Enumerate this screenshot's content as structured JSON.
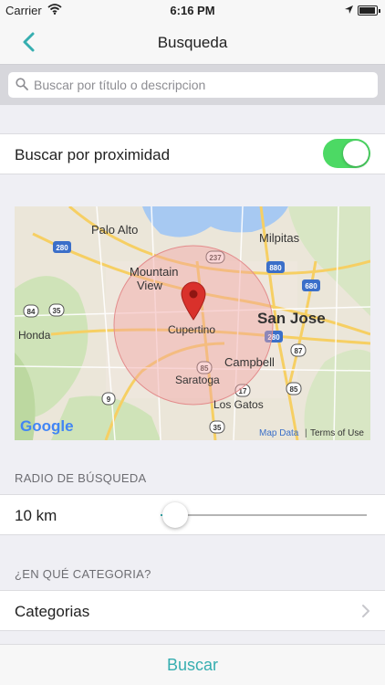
{
  "status_bar": {
    "carrier": "Carrier",
    "time": "6:16 PM",
    "battery_level": 0.95,
    "icons": [
      "wifi-icon",
      "location-arrow-icon",
      "battery-icon"
    ]
  },
  "nav": {
    "title": "Busqueda",
    "back_icon": "chevron-left-icon"
  },
  "search": {
    "placeholder": "Buscar por título o descripcion",
    "value": ""
  },
  "proximity": {
    "label": "Buscar por proximidad",
    "enabled": true
  },
  "map": {
    "provider_logo": "Google",
    "map_data_label": "Map Data",
    "separator": "|",
    "terms_label": "Terms of Use",
    "places": [
      "Palo Alto",
      "Milpitas",
      "Mountain",
      "View",
      "San Jose",
      "Cupertino",
      "Campbell",
      "Saratoga",
      "Los Gatos",
      "Honda"
    ],
    "shields": [
      "280",
      "237",
      "880",
      "680",
      "84",
      "35",
      "85",
      "280",
      "87",
      "85",
      "9",
      "17",
      "35"
    ],
    "marker_icon": "map-pin-icon"
  },
  "radius": {
    "header": "RADIO DE BÚSQUEDA",
    "value_label": "10 km",
    "slider_fraction": 0.07
  },
  "category": {
    "header": "¿EN QUÉ CATEGORIA?",
    "label": "Categorias",
    "chevron_icon": "chevron-right-icon"
  },
  "footer": {
    "button_label": "Buscar"
  },
  "colors": {
    "accent": "#36aeb0",
    "toggle_on": "#4cd964",
    "marker": "#d9312b",
    "radius_fill": "#f2a5a5"
  }
}
